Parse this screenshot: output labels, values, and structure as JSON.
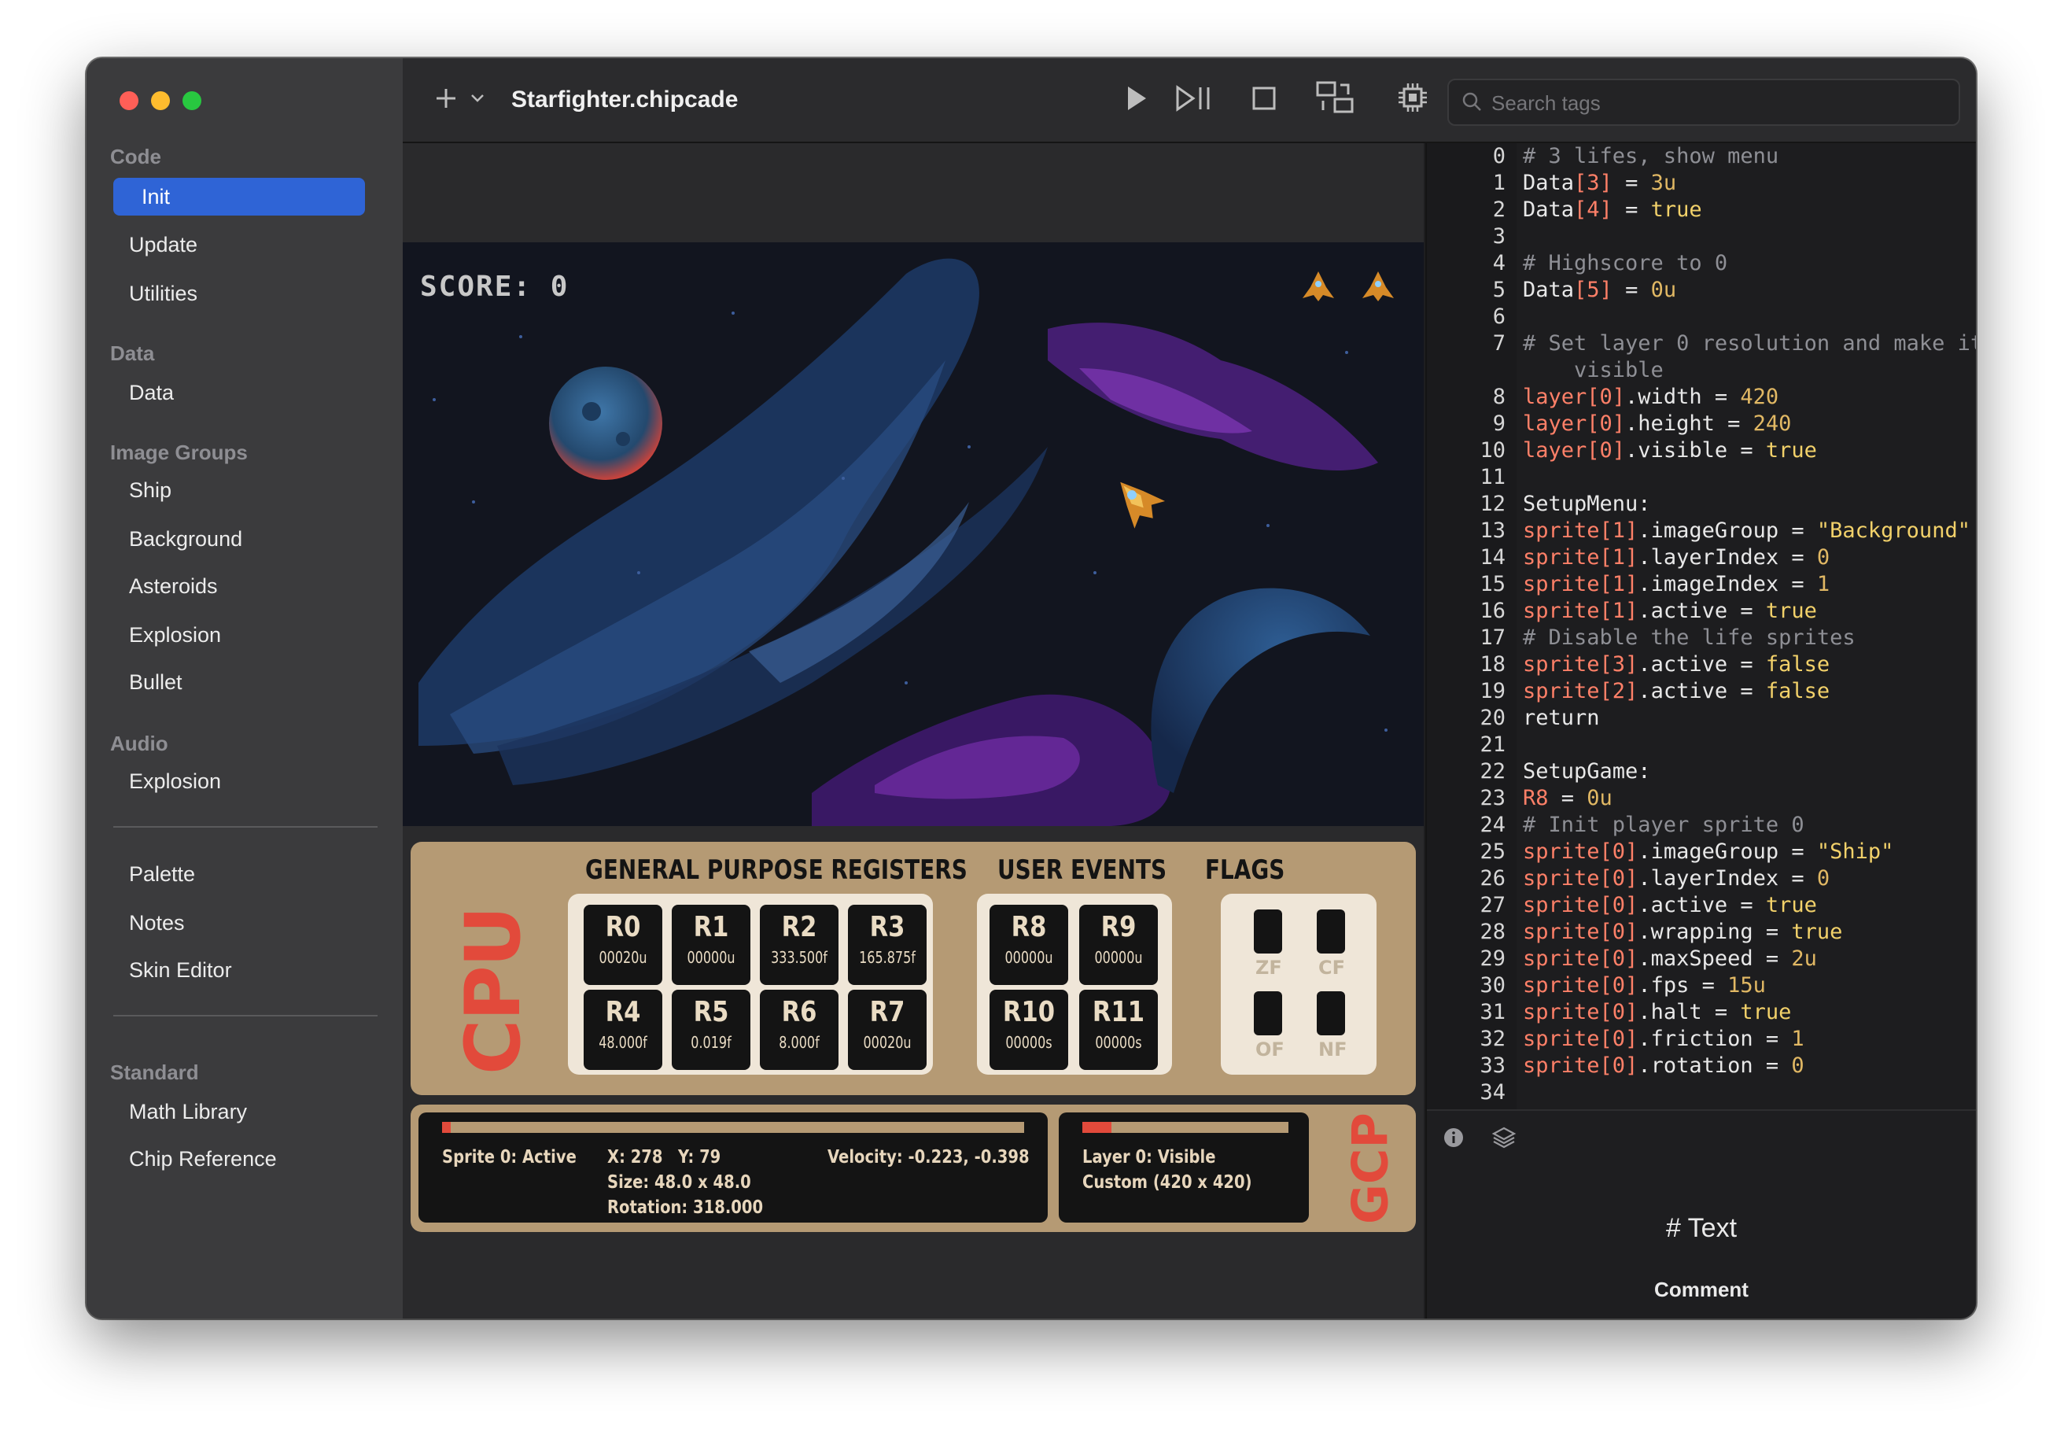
{
  "window": {
    "title": "Starfighter.chipcade"
  },
  "toolbar": {
    "add_icon": "plus-icon",
    "search_placeholder": "Search tags",
    "buttons": [
      "play-icon",
      "step-icon",
      "stop-icon",
      "swap-icon",
      "chip-icon",
      "power-icon"
    ]
  },
  "sidebar": {
    "sections": {
      "code": "Code",
      "data": "Data",
      "image_groups": "Image Groups",
      "audio": "Audio",
      "standard": "Standard"
    },
    "code_items": [
      "Init",
      "Update",
      "Utilities"
    ],
    "data_items": [
      "Data"
    ],
    "image_items": [
      "Ship",
      "Background",
      "Asteroids",
      "Explosion",
      "Bullet"
    ],
    "audio_items": [
      "Explosion"
    ],
    "misc_items": [
      "Palette",
      "Notes",
      "Skin Editor"
    ],
    "standard_items": [
      "Math Library",
      "Chip Reference"
    ],
    "selected": "Init"
  },
  "game": {
    "score": "SCORE: 0"
  },
  "cpu": {
    "label": "CPU",
    "gpr_title": "GENERAL PURPOSE REGISTERS",
    "user_events_title": "USER EVENTS",
    "flags_title": "FLAGS",
    "registers": [
      {
        "name": "R0",
        "value": "00020u"
      },
      {
        "name": "R1",
        "value": "00000u"
      },
      {
        "name": "R2",
        "value": "333.500f"
      },
      {
        "name": "R3",
        "value": "165.875f"
      },
      {
        "name": "R4",
        "value": "48.000f"
      },
      {
        "name": "R5",
        "value": "0.019f"
      },
      {
        "name": "R6",
        "value": "8.000f"
      },
      {
        "name": "R7",
        "value": "00020u"
      }
    ],
    "user_events": [
      {
        "name": "R8",
        "value": "00000u"
      },
      {
        "name": "R9",
        "value": "00000u"
      },
      {
        "name": "R10",
        "value": "00000s"
      },
      {
        "name": "R11",
        "value": "00000s"
      }
    ],
    "flags": [
      "ZF",
      "CF",
      "OF",
      "NF"
    ]
  },
  "gcp": {
    "label": "GCP",
    "sprite_progress": 0.015,
    "sprite_status": "Sprite 0: Active",
    "pos_x": "X: 278",
    "pos_y": "Y: 79",
    "velocity": "Velocity: -0.223, -0.398",
    "size": "Size: 48.0 x 48.0",
    "rotation": "Rotation: 318.000",
    "layer_progress": 0.14,
    "layer_status": "Layer 0: Visible",
    "layer_res": "Custom (420 x 420)"
  },
  "code": {
    "lines": [
      {
        "n": "0",
        "t": [
          [
            "c-comment",
            "# 3 lifes, show menu"
          ]
        ]
      },
      {
        "n": "1",
        "t": [
          [
            "c-plain",
            "Data"
          ],
          [
            "c-var",
            "[3]"
          ],
          [
            "c-plain",
            " = "
          ],
          [
            "c-num",
            "3u"
          ]
        ]
      },
      {
        "n": "2",
        "t": [
          [
            "c-plain",
            "Data"
          ],
          [
            "c-var",
            "[4]"
          ],
          [
            "c-plain",
            " = "
          ],
          [
            "c-bool",
            "true"
          ]
        ]
      },
      {
        "n": "3",
        "t": []
      },
      {
        "n": "4",
        "t": [
          [
            "c-comment",
            "# Highscore to 0"
          ]
        ]
      },
      {
        "n": "5",
        "t": [
          [
            "c-plain",
            "Data"
          ],
          [
            "c-var",
            "[5]"
          ],
          [
            "c-plain",
            " = "
          ],
          [
            "c-num",
            "0u"
          ]
        ]
      },
      {
        "n": "6",
        "t": []
      },
      {
        "n": "7",
        "t": [
          [
            "c-comment",
            "# Set layer 0 resolution and make it"
          ]
        ]
      },
      {
        "n": "",
        "t": [
          [
            "c-comment",
            "    visible"
          ]
        ]
      },
      {
        "n": "8",
        "t": [
          [
            "c-var",
            "layer[0]"
          ],
          [
            "c-plain",
            ".width = "
          ],
          [
            "c-num",
            "420"
          ]
        ]
      },
      {
        "n": "9",
        "t": [
          [
            "c-var",
            "layer[0]"
          ],
          [
            "c-plain",
            ".height = "
          ],
          [
            "c-num",
            "240"
          ]
        ]
      },
      {
        "n": "10",
        "t": [
          [
            "c-var",
            "layer[0]"
          ],
          [
            "c-plain",
            ".visible = "
          ],
          [
            "c-bool",
            "true"
          ]
        ]
      },
      {
        "n": "11",
        "t": []
      },
      {
        "n": "12",
        "t": [
          [
            "c-plain",
            "SetupMenu:"
          ]
        ]
      },
      {
        "n": "13",
        "t": [
          [
            "c-var",
            "sprite[1]"
          ],
          [
            "c-plain",
            ".imageGroup = "
          ],
          [
            "c-str",
            "\"Background\""
          ]
        ]
      },
      {
        "n": "14",
        "t": [
          [
            "c-var",
            "sprite[1]"
          ],
          [
            "c-plain",
            ".layerIndex = "
          ],
          [
            "c-num",
            "0"
          ]
        ]
      },
      {
        "n": "15",
        "t": [
          [
            "c-var",
            "sprite[1]"
          ],
          [
            "c-plain",
            ".imageIndex = "
          ],
          [
            "c-num",
            "1"
          ]
        ]
      },
      {
        "n": "16",
        "t": [
          [
            "c-var",
            "sprite[1]"
          ],
          [
            "c-plain",
            ".active = "
          ],
          [
            "c-bool",
            "true"
          ]
        ]
      },
      {
        "n": "17",
        "t": [
          [
            "c-comment",
            "# Disable the life sprites"
          ]
        ]
      },
      {
        "n": "18",
        "t": [
          [
            "c-var",
            "sprite[3]"
          ],
          [
            "c-plain",
            ".active = "
          ],
          [
            "c-bool",
            "false"
          ]
        ]
      },
      {
        "n": "19",
        "t": [
          [
            "c-var",
            "sprite[2]"
          ],
          [
            "c-plain",
            ".active = "
          ],
          [
            "c-bool",
            "false"
          ]
        ]
      },
      {
        "n": "20",
        "t": [
          [
            "c-plain",
            "return"
          ]
        ]
      },
      {
        "n": "21",
        "t": []
      },
      {
        "n": "22",
        "t": [
          [
            "c-plain",
            "SetupGame:"
          ]
        ]
      },
      {
        "n": "23",
        "t": [
          [
            "c-var",
            "R8"
          ],
          [
            "c-plain",
            " = "
          ],
          [
            "c-num",
            "0u"
          ]
        ]
      },
      {
        "n": "24",
        "t": [
          [
            "c-comment",
            "# Init player sprite 0"
          ]
        ]
      },
      {
        "n": "25",
        "t": [
          [
            "c-var",
            "sprite[0]"
          ],
          [
            "c-plain",
            ".imageGroup = "
          ],
          [
            "c-str",
            "\"Ship\""
          ]
        ]
      },
      {
        "n": "26",
        "t": [
          [
            "c-var",
            "sprite[0]"
          ],
          [
            "c-plain",
            ".layerIndex = "
          ],
          [
            "c-num",
            "0"
          ]
        ]
      },
      {
        "n": "27",
        "t": [
          [
            "c-var",
            "sprite[0]"
          ],
          [
            "c-plain",
            ".active = "
          ],
          [
            "c-bool",
            "true"
          ]
        ]
      },
      {
        "n": "28",
        "t": [
          [
            "c-var",
            "sprite[0]"
          ],
          [
            "c-plain",
            ".wrapping = "
          ],
          [
            "c-bool",
            "true"
          ]
        ]
      },
      {
        "n": "29",
        "t": [
          [
            "c-var",
            "sprite[0]"
          ],
          [
            "c-plain",
            ".maxSpeed = "
          ],
          [
            "c-num",
            "2u"
          ]
        ]
      },
      {
        "n": "30",
        "t": [
          [
            "c-var",
            "sprite[0]"
          ],
          [
            "c-plain",
            ".fps = "
          ],
          [
            "c-num",
            "15u"
          ]
        ]
      },
      {
        "n": "31",
        "t": [
          [
            "c-var",
            "sprite[0]"
          ],
          [
            "c-plain",
            ".halt = "
          ],
          [
            "c-bool",
            "true"
          ]
        ]
      },
      {
        "n": "32",
        "t": [
          [
            "c-var",
            "sprite[0]"
          ],
          [
            "c-plain",
            ".friction = "
          ],
          [
            "c-num",
            "1"
          ]
        ]
      },
      {
        "n": "33",
        "t": [
          [
            "c-var",
            "sprite[0]"
          ],
          [
            "c-plain",
            ".rotation = "
          ],
          [
            "c-num",
            "0"
          ]
        ]
      },
      {
        "n": "34",
        "t": []
      }
    ]
  },
  "inspector": {
    "title": "# Text",
    "subtitle": "Comment"
  }
}
